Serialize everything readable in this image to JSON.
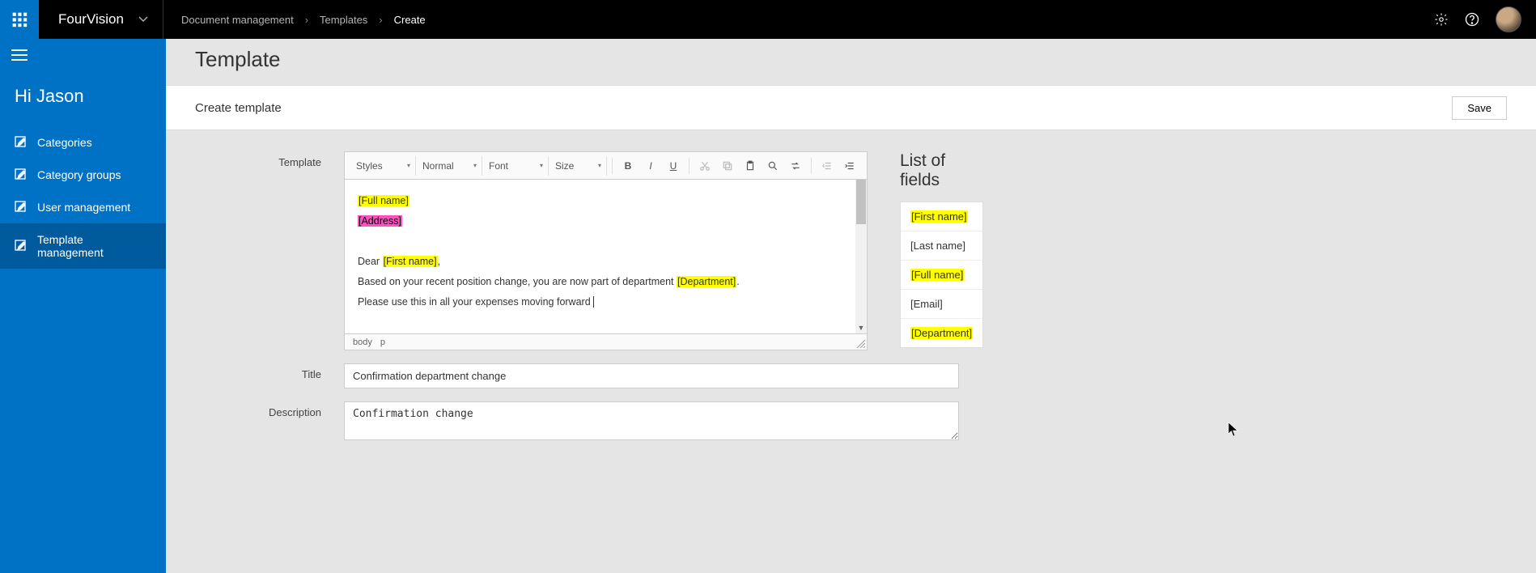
{
  "topbar": {
    "app_name": "FourVision",
    "breadcrumb": [
      "Document management",
      "Templates",
      "Create"
    ]
  },
  "sidebar": {
    "greeting": "Hi Jason",
    "items": [
      {
        "label": "Categories",
        "active": false
      },
      {
        "label": "Category groups",
        "active": false
      },
      {
        "label": "User management",
        "active": false
      },
      {
        "label": "Template management",
        "active": true
      }
    ]
  },
  "page": {
    "title": "Template",
    "subtitle": "Create template",
    "save_label": "Save"
  },
  "form": {
    "template_label": "Template",
    "title_label": "Title",
    "title_value": "Confirmation department change",
    "description_label": "Description",
    "description_value": "Confirmation change"
  },
  "editor": {
    "toolbar": {
      "styles": "Styles",
      "format": "Normal",
      "font": "Font",
      "size": "Size"
    },
    "content": {
      "token_full_name": "[Full name]",
      "token_address": "[Address]",
      "line_dear_pre": "Dear ",
      "token_first_name": "[First name]",
      "line_dear_post": ",",
      "line_dept_pre": "Based on your recent position change, you are now part of department ",
      "token_department": "[Department]",
      "line_dept_post": ".",
      "line_expenses": "Please use this in all your expenses moving forward "
    },
    "footer": {
      "path1": "body",
      "path2": "p"
    }
  },
  "field_panel": {
    "title": "List of fields",
    "fields": [
      {
        "label": "[First name]",
        "highlight": true
      },
      {
        "label": "[Last name]",
        "highlight": false
      },
      {
        "label": "[Full name]",
        "highlight": true
      },
      {
        "label": "[Email]",
        "highlight": false
      },
      {
        "label": "[Department]",
        "highlight": true
      }
    ]
  }
}
